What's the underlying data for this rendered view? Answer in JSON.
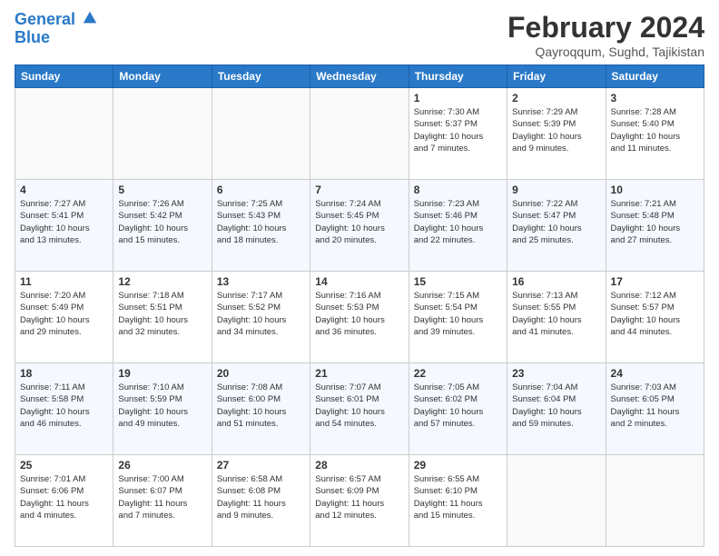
{
  "header": {
    "logo_line1": "General",
    "logo_line2": "Blue",
    "month": "February 2024",
    "location": "Qayroqqum, Sughd, Tajikistan"
  },
  "weekdays": [
    "Sunday",
    "Monday",
    "Tuesday",
    "Wednesday",
    "Thursday",
    "Friday",
    "Saturday"
  ],
  "weeks": [
    [
      {
        "day": "",
        "info": ""
      },
      {
        "day": "",
        "info": ""
      },
      {
        "day": "",
        "info": ""
      },
      {
        "day": "",
        "info": ""
      },
      {
        "day": "1",
        "info": "Sunrise: 7:30 AM\nSunset: 5:37 PM\nDaylight: 10 hours\nand 7 minutes."
      },
      {
        "day": "2",
        "info": "Sunrise: 7:29 AM\nSunset: 5:39 PM\nDaylight: 10 hours\nand 9 minutes."
      },
      {
        "day": "3",
        "info": "Sunrise: 7:28 AM\nSunset: 5:40 PM\nDaylight: 10 hours\nand 11 minutes."
      }
    ],
    [
      {
        "day": "4",
        "info": "Sunrise: 7:27 AM\nSunset: 5:41 PM\nDaylight: 10 hours\nand 13 minutes."
      },
      {
        "day": "5",
        "info": "Sunrise: 7:26 AM\nSunset: 5:42 PM\nDaylight: 10 hours\nand 15 minutes."
      },
      {
        "day": "6",
        "info": "Sunrise: 7:25 AM\nSunset: 5:43 PM\nDaylight: 10 hours\nand 18 minutes."
      },
      {
        "day": "7",
        "info": "Sunrise: 7:24 AM\nSunset: 5:45 PM\nDaylight: 10 hours\nand 20 minutes."
      },
      {
        "day": "8",
        "info": "Sunrise: 7:23 AM\nSunset: 5:46 PM\nDaylight: 10 hours\nand 22 minutes."
      },
      {
        "day": "9",
        "info": "Sunrise: 7:22 AM\nSunset: 5:47 PM\nDaylight: 10 hours\nand 25 minutes."
      },
      {
        "day": "10",
        "info": "Sunrise: 7:21 AM\nSunset: 5:48 PM\nDaylight: 10 hours\nand 27 minutes."
      }
    ],
    [
      {
        "day": "11",
        "info": "Sunrise: 7:20 AM\nSunset: 5:49 PM\nDaylight: 10 hours\nand 29 minutes."
      },
      {
        "day": "12",
        "info": "Sunrise: 7:18 AM\nSunset: 5:51 PM\nDaylight: 10 hours\nand 32 minutes."
      },
      {
        "day": "13",
        "info": "Sunrise: 7:17 AM\nSunset: 5:52 PM\nDaylight: 10 hours\nand 34 minutes."
      },
      {
        "day": "14",
        "info": "Sunrise: 7:16 AM\nSunset: 5:53 PM\nDaylight: 10 hours\nand 36 minutes."
      },
      {
        "day": "15",
        "info": "Sunrise: 7:15 AM\nSunset: 5:54 PM\nDaylight: 10 hours\nand 39 minutes."
      },
      {
        "day": "16",
        "info": "Sunrise: 7:13 AM\nSunset: 5:55 PM\nDaylight: 10 hours\nand 41 minutes."
      },
      {
        "day": "17",
        "info": "Sunrise: 7:12 AM\nSunset: 5:57 PM\nDaylight: 10 hours\nand 44 minutes."
      }
    ],
    [
      {
        "day": "18",
        "info": "Sunrise: 7:11 AM\nSunset: 5:58 PM\nDaylight: 10 hours\nand 46 minutes."
      },
      {
        "day": "19",
        "info": "Sunrise: 7:10 AM\nSunset: 5:59 PM\nDaylight: 10 hours\nand 49 minutes."
      },
      {
        "day": "20",
        "info": "Sunrise: 7:08 AM\nSunset: 6:00 PM\nDaylight: 10 hours\nand 51 minutes."
      },
      {
        "day": "21",
        "info": "Sunrise: 7:07 AM\nSunset: 6:01 PM\nDaylight: 10 hours\nand 54 minutes."
      },
      {
        "day": "22",
        "info": "Sunrise: 7:05 AM\nSunset: 6:02 PM\nDaylight: 10 hours\nand 57 minutes."
      },
      {
        "day": "23",
        "info": "Sunrise: 7:04 AM\nSunset: 6:04 PM\nDaylight: 10 hours\nand 59 minutes."
      },
      {
        "day": "24",
        "info": "Sunrise: 7:03 AM\nSunset: 6:05 PM\nDaylight: 11 hours\nand 2 minutes."
      }
    ],
    [
      {
        "day": "25",
        "info": "Sunrise: 7:01 AM\nSunset: 6:06 PM\nDaylight: 11 hours\nand 4 minutes."
      },
      {
        "day": "26",
        "info": "Sunrise: 7:00 AM\nSunset: 6:07 PM\nDaylight: 11 hours\nand 7 minutes."
      },
      {
        "day": "27",
        "info": "Sunrise: 6:58 AM\nSunset: 6:08 PM\nDaylight: 11 hours\nand 9 minutes."
      },
      {
        "day": "28",
        "info": "Sunrise: 6:57 AM\nSunset: 6:09 PM\nDaylight: 11 hours\nand 12 minutes."
      },
      {
        "day": "29",
        "info": "Sunrise: 6:55 AM\nSunset: 6:10 PM\nDaylight: 11 hours\nand 15 minutes."
      },
      {
        "day": "",
        "info": ""
      },
      {
        "day": "",
        "info": ""
      }
    ]
  ]
}
